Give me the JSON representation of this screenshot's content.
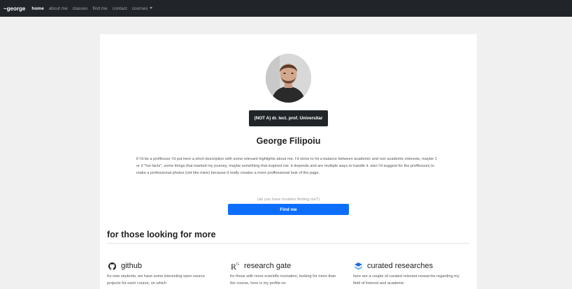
{
  "navbar": {
    "brand": "~george",
    "links": [
      "home",
      "about me",
      "classes",
      "find me",
      "contact",
      "courses"
    ]
  },
  "profile": {
    "badge": "(NOT A) dr. lect. prof. Universitar",
    "name": "George Filipoiu",
    "bio": "if I'd be a proffessor I'd put here a short description with some relevant highlights about me. I'd strive to hit a balance between academic and non academic interests, maybe 1 or 2 \"fun facts\", some things that marked my journey, maybe something that inspired me. it depends and are multiple ways to handle it. also I'd suggest for the proffessors to make a professional photos (not like mine) because it really creates a more proffessional look of the page.",
    "hint": "(do you have troubles finding me?)",
    "find_button": "Find me"
  },
  "more": {
    "title": "for those looking for more",
    "items": [
      {
        "title": "github",
        "icon": "github-icon",
        "desc": "for new students, we have some interesting open source projects for each course, on which"
      },
      {
        "title": "research gate",
        "icon": "researchgate-icon",
        "desc": "for those with more scientific incination, looking for more than the course, here is my profile on"
      },
      {
        "title": "curated researches",
        "icon": "layers-icon",
        "desc": "here are a couple of curated relevant researchs regarding my field of interest and academic"
      }
    ]
  },
  "colors": {
    "navbar": "#212529",
    "accent": "#0d6efd",
    "page_bg": "#f0f0f0"
  }
}
